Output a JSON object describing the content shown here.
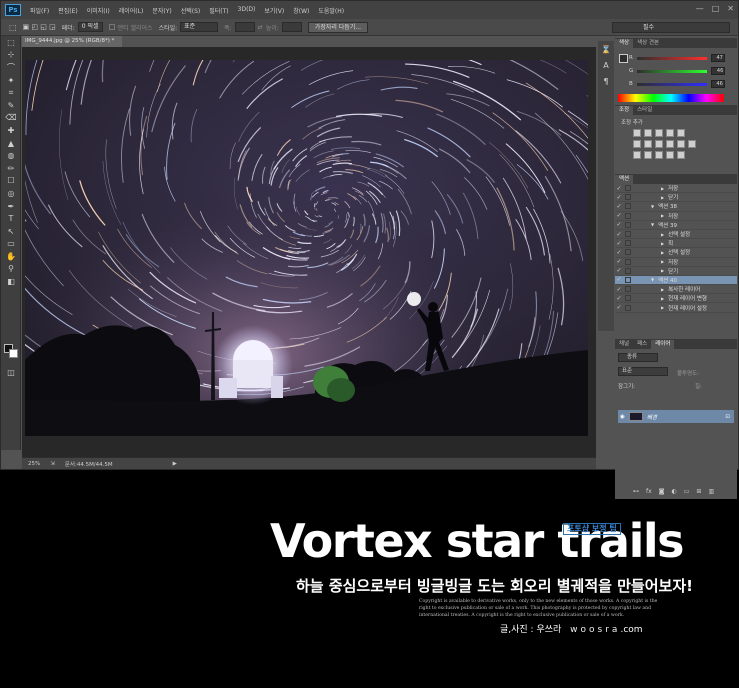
{
  "menubar": {
    "logo": "Ps",
    "items": [
      "파일(F)",
      "편집(E)",
      "이미지(I)",
      "레이어(L)",
      "문자(Y)",
      "선택(S)",
      "필터(T)",
      "3D(D)",
      "보기(V)",
      "창(W)",
      "도움말(H)"
    ],
    "window_buttons": [
      "—",
      "□",
      "✕"
    ]
  },
  "options": {
    "feather_label": "페더:",
    "feather_value": "0 픽셀",
    "antialias": "앤티 앨리어스",
    "style_label": "스타일:",
    "style_value": "표준",
    "width_label": "폭:",
    "height_label": "높이:",
    "refine_button": "가장자리 다듬기...",
    "workspace": "필수"
  },
  "document": {
    "tab_title": "IMG_9444.jpg @ 25% (RGB/8*) *",
    "zoom": "25%",
    "doc_size": "문서:44.5M/44.5M"
  },
  "panels": {
    "color_tabs": [
      "색상",
      "색상 견본"
    ],
    "rgb": [
      {
        "label": "R",
        "value": "47"
      },
      {
        "label": "G",
        "value": "46"
      },
      {
        "label": "B",
        "value": "46"
      }
    ],
    "adjust_tabs": [
      "조정",
      "스타일"
    ],
    "adjust_add": "조정 추가",
    "actions_tab": "액션",
    "actions": [
      {
        "label": "저장",
        "indent": 2,
        "selected": false
      },
      {
        "label": "닫기",
        "indent": 2,
        "selected": false
      },
      {
        "label": "액션 38",
        "indent": 1,
        "selected": false
      },
      {
        "label": "저장",
        "indent": 2,
        "selected": false
      },
      {
        "label": "액션 39",
        "indent": 1,
        "selected": false
      },
      {
        "label": "선택 설정",
        "indent": 2,
        "selected": false
      },
      {
        "label": "획",
        "indent": 2,
        "selected": false
      },
      {
        "label": "선택 설정",
        "indent": 2,
        "selected": false
      },
      {
        "label": "저장",
        "indent": 2,
        "selected": false
      },
      {
        "label": "닫기",
        "indent": 2,
        "selected": false
      },
      {
        "label": "액션 40",
        "indent": 1,
        "selected": true
      },
      {
        "label": "복사한 레이어",
        "indent": 2,
        "selected": false
      },
      {
        "label": "현재 레이어 변형",
        "indent": 2,
        "selected": false
      },
      {
        "label": "현재 레이어 설정",
        "indent": 2,
        "selected": false
      }
    ],
    "layers_tabs": [
      "채널",
      "패스",
      "레이어"
    ],
    "layer_kind": "종류",
    "blend_mode": "표준",
    "opacity_label": "불투명도:",
    "lock_label": "잠그기:",
    "fill_label": "칠:",
    "layer_name": "배경"
  },
  "banner": {
    "title": "Vortex star trails",
    "tag": "포토샵 보정 팁",
    "subtitle": "하늘 중심으로부터 빙글빙글 도는 회오리 별궤적을 만들어보자!",
    "copyright": "Copyright is available to derivative works, only to the new elements of those works. A copyright is the right to exclusive publication or sale of a work. This photography is protected by copyright law and international treaties. A copyright is the right to exclusive publication or sale of a work.",
    "credit_prefix": "글,사진 : 우쓰라",
    "credit_brand": "woosra",
    "credit_suffix": ".com"
  },
  "colors": {
    "sky_top": "#231e2e",
    "sky_glow": "#6b5a7a",
    "selection": "#7a94b3",
    "tag_blue": "#3b86d1"
  }
}
